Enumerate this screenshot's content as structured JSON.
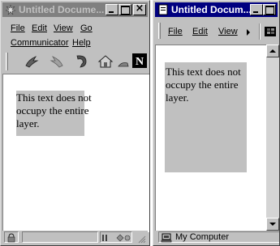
{
  "colors": {
    "active_title": "#000080",
    "inactive_title": "#808080",
    "layer_background": "#c0c0c0",
    "window_face": "#c0c0c0",
    "content_background": "#ffffff"
  },
  "left_window": {
    "title": "Untitled Docume...",
    "app_icon": "netscape-star-icon",
    "menu": [
      "File",
      "Edit",
      "View",
      "Go",
      "Communicator",
      "Help"
    ],
    "toolbar_icons": [
      "back-icon",
      "forward-icon",
      "reload-icon",
      "home-icon",
      "netscape-n-icon"
    ],
    "layer_text": "This text does not occupy the entire layer.",
    "status_icons": [
      "security-lock-icon",
      "component-bar-icon"
    ]
  },
  "right_window": {
    "title": "Untitled Docum...",
    "app_icon": "ie-document-icon",
    "menu": [
      "File",
      "Edit",
      "View"
    ],
    "layer_text": "This text does not occupy the entire layer.",
    "status_text": "My Computer",
    "status_icon": "my-computer-icon"
  }
}
